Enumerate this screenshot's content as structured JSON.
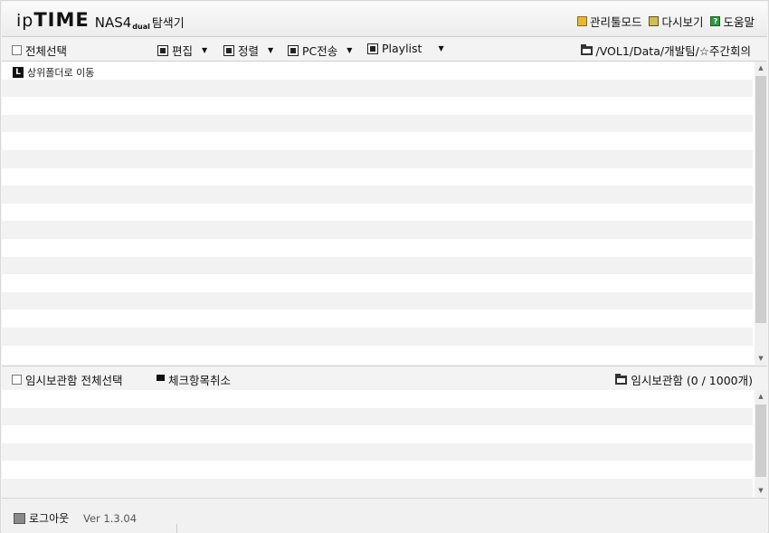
{
  "header": {
    "logo_ip": "ip",
    "logo_time": "TIME",
    "logo_model": "NAS4",
    "logo_dual": "dual",
    "logo_explorer": "탐색기",
    "admin_mode": "관리툴모드",
    "refresh": "다시보기",
    "help": "도움말"
  },
  "toolbar": {
    "select_all": "전체선택",
    "edit": "편집",
    "sort": "정렬",
    "pc_transfer": "PC전송",
    "playlist": "Playlist",
    "path": "/VOL1/Data/개발팀/☆주간회의"
  },
  "file_list": {
    "up_folder": "상위폴더로 이동",
    "up_icon_glyph": "L"
  },
  "temp_bar": {
    "select_all": "임시보관함 전체선택",
    "uncheck": "체크항목취소",
    "storage_label": "임시보관함 (0 / 1000개)"
  },
  "footer": {
    "logout": "로그아웃",
    "version": "Ver 1.3.04"
  },
  "icons": {
    "admin": "folder-yellow-icon",
    "refresh": "refresh-icon",
    "help": "help-icon",
    "up": "up-folder-icon",
    "path": "folder-icon",
    "logout": "logout-icon"
  },
  "colors": {
    "row_stripe": "#f2f2f2",
    "scroll_thumb": "#cdcdcd",
    "help_icon": "#2f9b3c",
    "admin_icon": "#e8b73a"
  }
}
